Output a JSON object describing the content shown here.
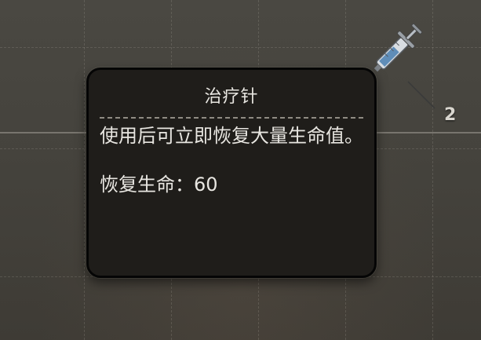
{
  "item": {
    "name": "治疗针",
    "description": "使用后可立即恢复大量生命值。",
    "stat_label": "恢复生命：",
    "stat_value": "60",
    "count": "2",
    "icon": "syringe-icon"
  },
  "colors": {
    "background": "#45433d",
    "tooltip_bg": "#1f1d1a",
    "tooltip_border": "#050505",
    "text": "#e8e6e1",
    "divider": "#8f8b84"
  }
}
